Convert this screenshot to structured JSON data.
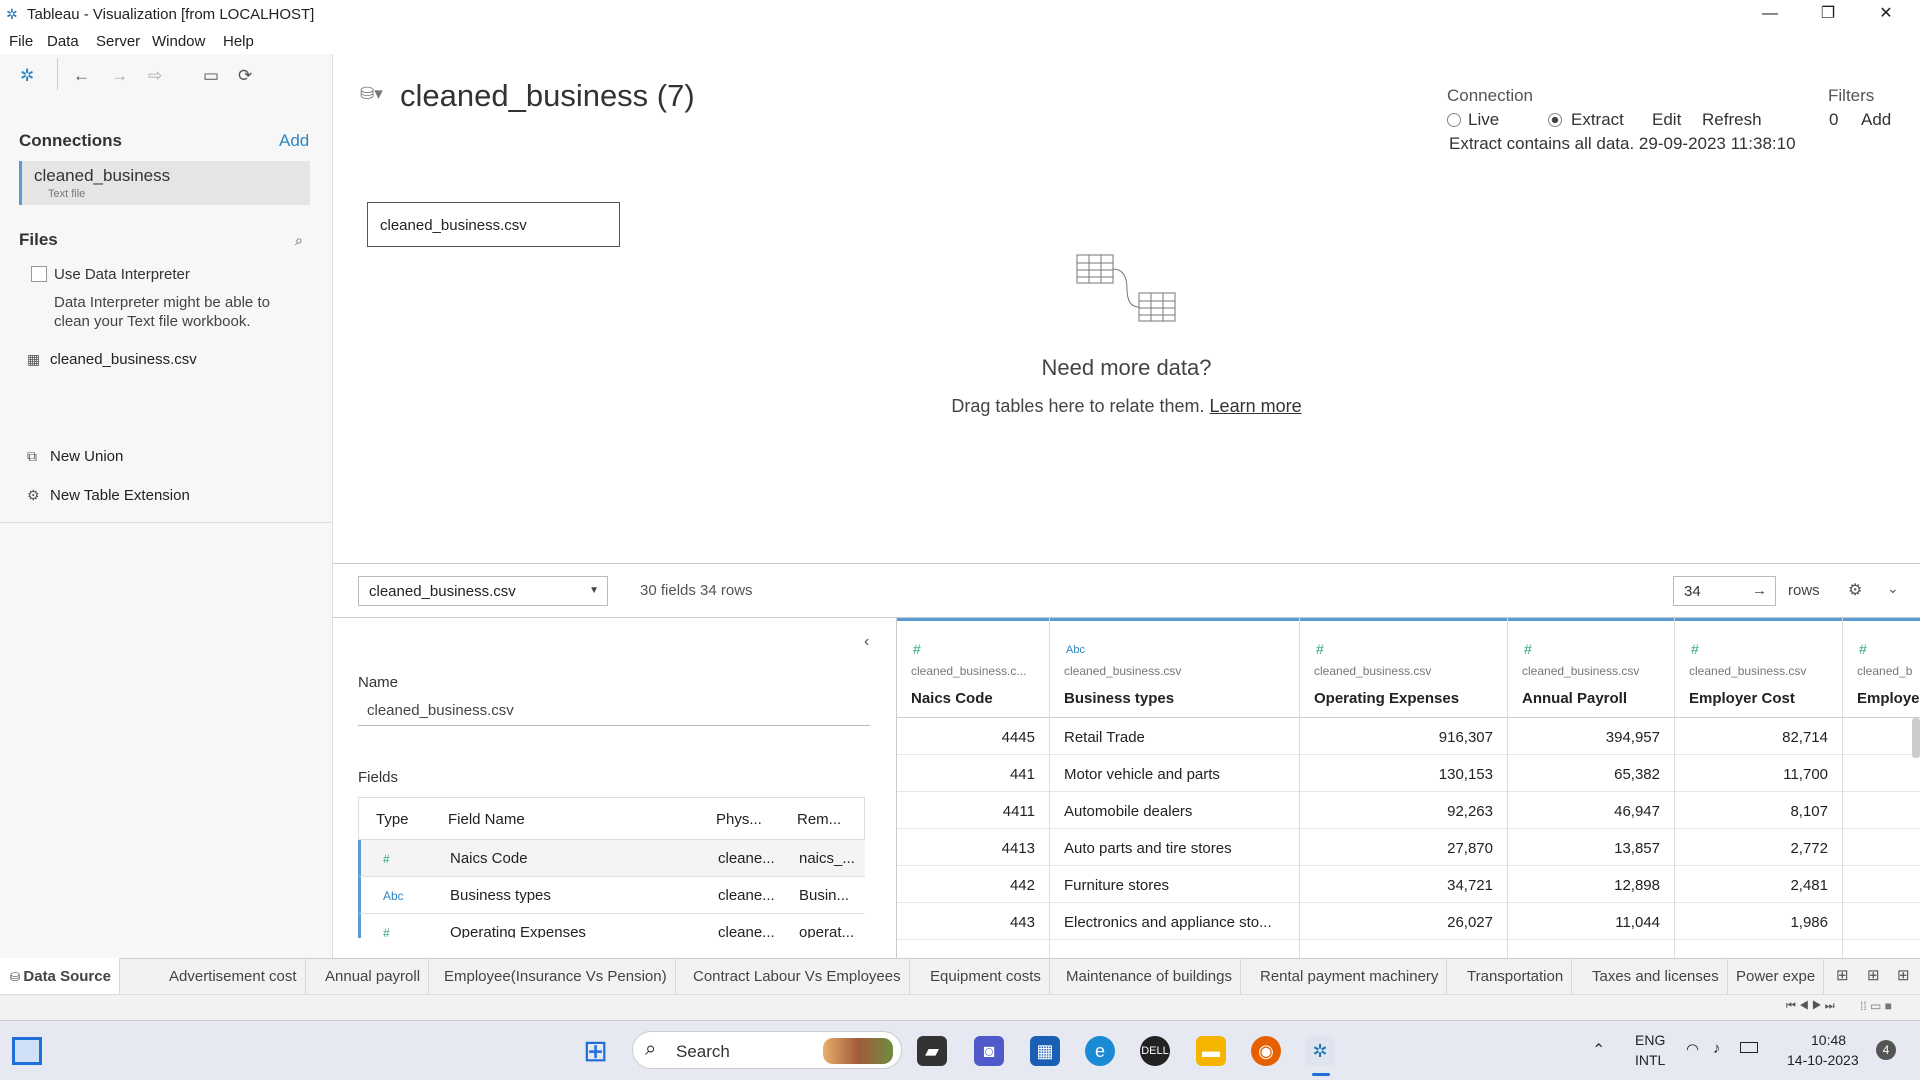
{
  "window": {
    "title": "Tableau - Visualization [from LOCALHOST]",
    "minimize": "—",
    "restore": "❐",
    "close": "✕"
  },
  "menu": [
    "File",
    "Data",
    "Server",
    "Window",
    "Help"
  ],
  "left": {
    "connections_label": "Connections",
    "add_label": "Add",
    "connection": {
      "name": "cleaned_business",
      "type": "Text file"
    },
    "files_label": "Files",
    "use_interpreter": "Use Data Interpreter",
    "interpreter_note_line1": "Data Interpreter might be able to",
    "interpreter_note_line2": "clean your Text file workbook.",
    "file": "cleaned_business.csv",
    "new_union": "New Union",
    "new_table_extension": "New Table Extension"
  },
  "canvas": {
    "title": "cleaned_business (7)",
    "table_box": "cleaned_business.csv",
    "need_more": "Need more data?",
    "drag_text": "Drag tables here to relate them.",
    "learn_more": "Learn more"
  },
  "connection": {
    "label": "Connection",
    "live": "Live",
    "extract": "Extract",
    "edit": "Edit",
    "refresh": "Refresh",
    "extract_note": "Extract contains all data. 29-09-2023 11:38:10",
    "filters_label": "Filters",
    "filters_count": "0",
    "filters_add": "Add"
  },
  "lower": {
    "table_select": "cleaned_business.csv",
    "summary": "30 fields 34 rows",
    "rows_value": "34",
    "rows_label": "rows"
  },
  "meta": {
    "name_label": "Name",
    "name_value": "cleaned_business.csv",
    "fields_label": "Fields",
    "headers": [
      "Type",
      "Field Name",
      "Phys...",
      "Rem..."
    ],
    "rows": [
      {
        "type": "#",
        "name": "Naics Code",
        "phys": "cleane...",
        "rem": "naics_..."
      },
      {
        "type": "Abc",
        "name": "Business types",
        "phys": "cleane...",
        "rem": "Busin..."
      },
      {
        "type": "#",
        "name": "Operating Expenses",
        "phys": "cleane...",
        "rem": "operat..."
      }
    ]
  },
  "grid": {
    "columns": [
      {
        "type": "#",
        "source": "cleaned_business.c...",
        "name": "Naics Code",
        "align": "num"
      },
      {
        "type": "Abc",
        "source": "cleaned_business.csv",
        "name": "Business types",
        "align": "txt"
      },
      {
        "type": "#",
        "source": "cleaned_business.csv",
        "name": "Operating Expenses",
        "align": "num"
      },
      {
        "type": "#",
        "source": "cleaned_business.csv",
        "name": "Annual Payroll",
        "align": "num"
      },
      {
        "type": "#",
        "source": "cleaned_business.csv",
        "name": "Employer Cost",
        "align": "num"
      },
      {
        "type": "#",
        "source": "cleaned_b",
        "name": "Employe",
        "align": "num"
      }
    ],
    "rows": [
      [
        "4445",
        "Retail Trade",
        "916,307",
        "394,957",
        "82,714",
        ""
      ],
      [
        "441",
        "Motor vehicle and parts",
        "130,153",
        "65,382",
        "11,700",
        ""
      ],
      [
        "4411",
        "Automobile dealers",
        "92,263",
        "46,947",
        "8,107",
        ""
      ],
      [
        "4413",
        "Auto parts and tire stores",
        "27,870",
        "13,857",
        "2,772",
        ""
      ],
      [
        "442",
        "Furniture stores",
        "34,721",
        "12,898",
        "2,481",
        ""
      ],
      [
        "443",
        "Electronics and appliance sto...",
        "26,027",
        "11,044",
        "1,986",
        ""
      ]
    ]
  },
  "tabs": [
    "Data Source",
    "Advertisement cost",
    "Annual payroll",
    "Employee(Insurance  Vs Pension)",
    "Contract Labour Vs Employees",
    "Equipment costs",
    "Maintenance of buildings",
    "Rental payment machinery",
    "Transportation",
    "Taxes and licenses",
    "Power expe"
  ],
  "taskbar": {
    "search": "Search",
    "lang1": "ENG",
    "lang2": "INTL",
    "time": "10:48",
    "date": "14-10-2023",
    "notif": "4"
  }
}
